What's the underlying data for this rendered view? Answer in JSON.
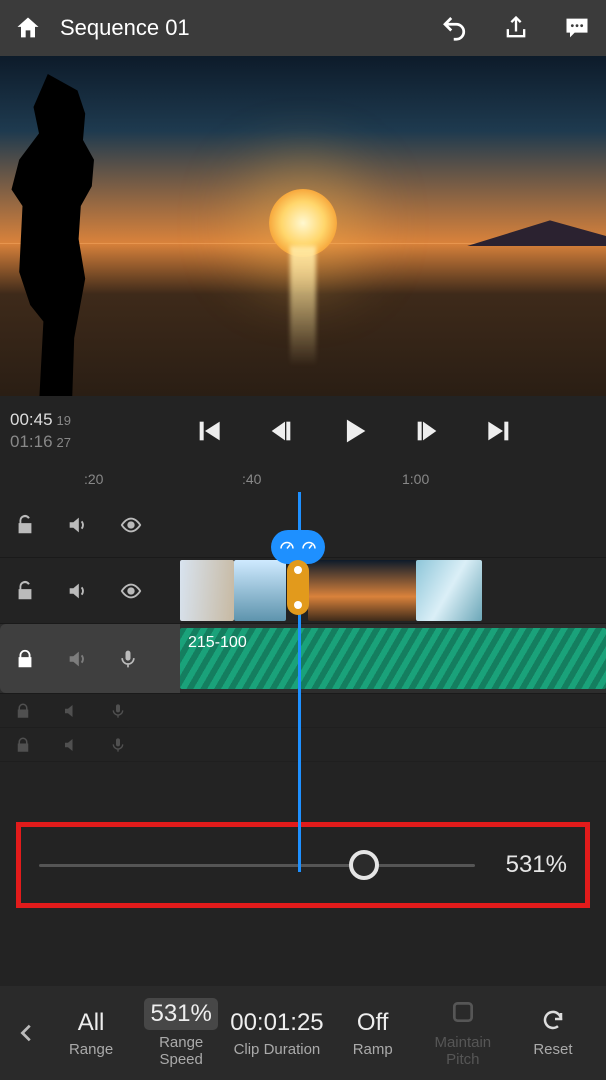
{
  "header": {
    "title": "Sequence 01"
  },
  "time": {
    "current": "00:45",
    "current_frames": "19",
    "total": "01:16",
    "total_frames": "27"
  },
  "ruler": {
    "t1": ":20",
    "t2": ":40",
    "t3": "1:00"
  },
  "audio": {
    "label": "215-100"
  },
  "slider": {
    "value": "531%"
  },
  "bottom": {
    "range": {
      "value": "All",
      "label": "Range"
    },
    "speed": {
      "value": "531%",
      "label": "Range Speed"
    },
    "duration": {
      "value": "00:01:25",
      "label": "Clip Duration"
    },
    "ramp": {
      "value": "Off",
      "label": "Ramp"
    },
    "pitch": {
      "value": "",
      "label": "Maintain Pitch"
    },
    "reset": {
      "value": "",
      "label": "Reset"
    }
  }
}
